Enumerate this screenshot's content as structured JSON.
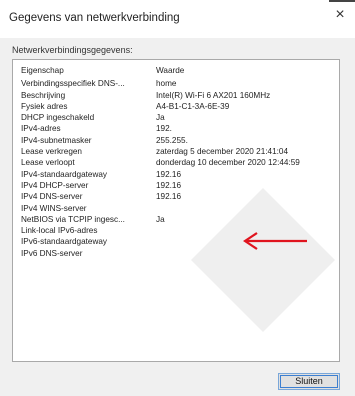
{
  "window": {
    "title": "Gegevens van netwerkverbinding",
    "close_glyph": "×"
  },
  "group": {
    "label": "Netwerkverbindingsgegevens:"
  },
  "table": {
    "header": {
      "key": "Eigenschap",
      "value": "Waarde"
    },
    "rows": [
      {
        "key": "Verbindingsspecifiek DNS-...",
        "value": "home"
      },
      {
        "key": "Beschrijving",
        "value": "Intel(R) Wi-Fi 6 AX201 160MHz"
      },
      {
        "key": "Fysiek adres",
        "value": "A4-B1-C1-3A-6E-39"
      },
      {
        "key": "DHCP ingeschakeld",
        "value": "Ja"
      },
      {
        "key": "IPv4-adres",
        "value": "192."
      },
      {
        "key": "IPv4-subnetmasker",
        "value": "255.255."
      },
      {
        "key": "Lease verkregen",
        "value": "zaterdag 5 december 2020 21:41:04"
      },
      {
        "key": "Lease verloopt",
        "value": "donderdag 10 december 2020 12:44:59"
      },
      {
        "key": "IPv4-standaardgateway",
        "value": "192.16"
      },
      {
        "key": "IPv4 DHCP-server",
        "value": "192.16"
      },
      {
        "key": "IPv4 DNS-server",
        "value": "192.16"
      },
      {
        "key": "IPv4 WINS-server",
        "value": ""
      },
      {
        "key": "NetBIOS via TCPIP ingesc...",
        "value": "Ja"
      },
      {
        "key": "Link-local IPv6-adres",
        "value": ""
      },
      {
        "key": "IPv6-standaardgateway",
        "value": ""
      },
      {
        "key": "IPv6 DNS-server",
        "value": ""
      }
    ]
  },
  "footer": {
    "close_button_label": "Sluiten"
  },
  "annotation": {
    "arrow_color": "#e0141e"
  }
}
